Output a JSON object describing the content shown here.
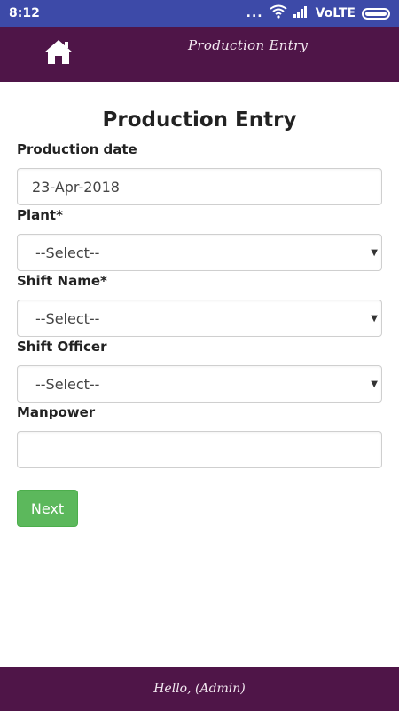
{
  "status_bar": {
    "time": "8:12",
    "dots": "...",
    "network": "VoLTE",
    "background": "#3d4aa8"
  },
  "header": {
    "title": "Production Entry",
    "home_icon": "home-icon",
    "background": "#4f1548"
  },
  "form": {
    "title": "Production Entry",
    "fields": [
      {
        "label": "Production date",
        "value": "23-Apr-2018",
        "type": "text"
      },
      {
        "label": "Plant*",
        "value": "--Select--",
        "type": "select"
      },
      {
        "label": "Shift Name*",
        "value": "--Select--",
        "type": "select"
      },
      {
        "label": "Shift Officer",
        "value": "--Select--",
        "type": "select"
      },
      {
        "label": "Manpower",
        "value": "",
        "type": "text"
      }
    ],
    "next_label": "Next",
    "next_color": "#5cb85c"
  },
  "footer": {
    "text": "Hello, (Admin)"
  }
}
